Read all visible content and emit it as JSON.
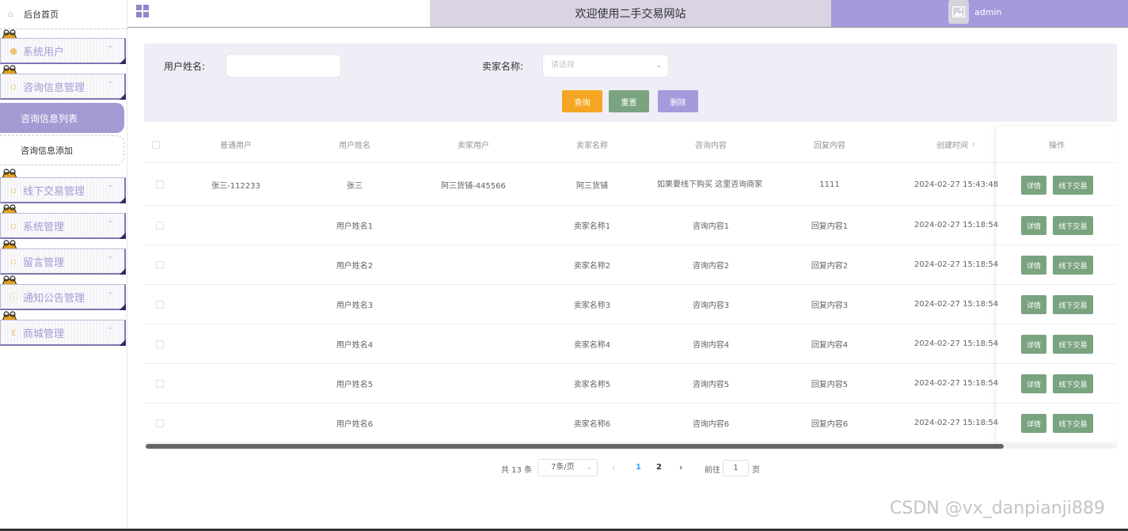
{
  "sidebar": {
    "home": "后台首页",
    "menus": [
      {
        "label": "系统用户",
        "icon": "user-icon"
      },
      {
        "label": "咨询信息管理",
        "icon": "doc-icon"
      },
      {
        "label": "线下交易管理",
        "icon": "doc-icon"
      },
      {
        "label": "系统管理",
        "icon": "doc-icon"
      },
      {
        "label": "留言管理",
        "icon": "doc-icon"
      },
      {
        "label": "通知公告管理",
        "icon": "info-icon"
      },
      {
        "label": "商城管理",
        "icon": "cart-icon"
      }
    ],
    "sub_active": "咨询信息列表",
    "sub_item": "咨询信息添加"
  },
  "header": {
    "title": "欢迎使用二手交易网站",
    "user": "admin"
  },
  "search": {
    "label_username": "用户姓名:",
    "label_seller": "卖家名称:",
    "seller_placeholder": "请选择",
    "btn_query": "查询",
    "btn_reset": "重置",
    "btn_delete": "删除"
  },
  "table": {
    "columns": [
      "普通用户",
      "用户姓名",
      "卖家用户",
      "卖家名称",
      "咨询内容",
      "回复内容",
      "创建时间",
      "操作"
    ],
    "rows": [
      {
        "user": "张三-112233",
        "name": "张三",
        "seller_user": "阿三货铺-445566",
        "seller": "阿三货铺",
        "content": "如果要线下购买 这里咨询商家",
        "reply": "1111",
        "time": "2024-02-27 15:43:48"
      },
      {
        "user": "",
        "name": "用户姓名1",
        "seller_user": "",
        "seller": "卖家名称1",
        "content": "咨询内容1",
        "reply": "回复内容1",
        "time": "2024-02-27 15:18:54"
      },
      {
        "user": "",
        "name": "用户姓名2",
        "seller_user": "",
        "seller": "卖家名称2",
        "content": "咨询内容2",
        "reply": "回复内容2",
        "time": "2024-02-27 15:18:54"
      },
      {
        "user": "",
        "name": "用户姓名3",
        "seller_user": "",
        "seller": "卖家名称3",
        "content": "咨询内容3",
        "reply": "回复内容3",
        "time": "2024-02-27 15:18:54"
      },
      {
        "user": "",
        "name": "用户姓名4",
        "seller_user": "",
        "seller": "卖家名称4",
        "content": "咨询内容4",
        "reply": "回复内容4",
        "time": "2024-02-27 15:18:54"
      },
      {
        "user": "",
        "name": "用户姓名5",
        "seller_user": "",
        "seller": "卖家名称5",
        "content": "咨询内容5",
        "reply": "回复内容5",
        "time": "2024-02-27 15:18:54"
      },
      {
        "user": "",
        "name": "用户姓名6",
        "seller_user": "",
        "seller": "卖家名称6",
        "content": "咨询内容6",
        "reply": "回复内容6",
        "time": "2024-02-27 15:18:54"
      }
    ],
    "op_detail": "详情",
    "op_offline": "线下交易"
  },
  "pagination": {
    "total": "共 13 条",
    "page_size": "7条/页",
    "page1": "1",
    "page2": "2",
    "goto": "前往",
    "jump_value": "1",
    "page_unit": "页"
  },
  "watermark": "CSDN @vx_danpianji889",
  "colors": {
    "accent": "#a39bdc",
    "query": "#f5a623",
    "green": "#7aa37f",
    "title_bar": "#d9d3e3"
  }
}
